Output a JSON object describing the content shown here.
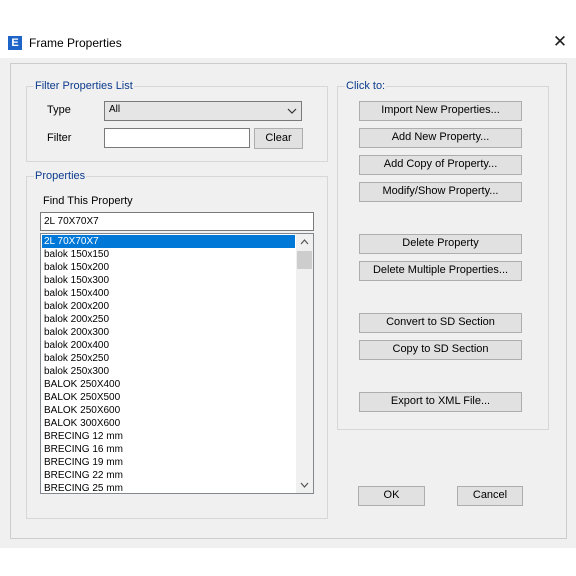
{
  "window": {
    "title": "Frame Properties",
    "icon_letter": "E",
    "close_glyph": "✕"
  },
  "filter": {
    "group_label": "Filter Properties List",
    "type_label": "Type",
    "type_value": "All",
    "filter_label": "Filter",
    "filter_value": "",
    "clear_label": "Clear"
  },
  "properties": {
    "group_label": "Properties",
    "find_label": "Find This Property",
    "find_value": "2L 70X70X7",
    "items": [
      "2L 70X70X7",
      "balok 150x150",
      "balok 150x200",
      "balok 150x300",
      "balok 150x400",
      "balok 200x200",
      "balok 200x250",
      "balok 200x300",
      "balok 200x400",
      "balok 250x250",
      "balok 250x300",
      "BALOK 250X400",
      "BALOK 250X500",
      "BALOK 250X600",
      "BALOK 300X600",
      "BRECING 12 mm",
      "BRECING 16 mm",
      "BRECING 19 mm",
      "BRECING 22 mm",
      "BRECING 25 mm"
    ],
    "selected_index": 0
  },
  "click_to": {
    "group_label": "Click to:",
    "import_label": "Import New Properties...",
    "add_new_label": "Add New Property...",
    "add_copy_label": "Add Copy of Property...",
    "modify_label": "Modify/Show Property...",
    "delete_label": "Delete Property",
    "delete_multiple_label": "Delete Multiple Properties...",
    "convert_sd_label": "Convert to SD Section",
    "copy_sd_label": "Copy to SD Section",
    "export_xml_label": "Export to XML File..."
  },
  "footer": {
    "ok_label": "OK",
    "cancel_label": "Cancel"
  },
  "colors": {
    "accent": "#0078d7",
    "group_label": "#0b3a8c",
    "dialog_bg": "#f0f0f0"
  },
  "icons": [
    "app-e-icon",
    "close-icon",
    "chevron-down-icon",
    "scroll-up-icon",
    "scroll-down-icon"
  ]
}
